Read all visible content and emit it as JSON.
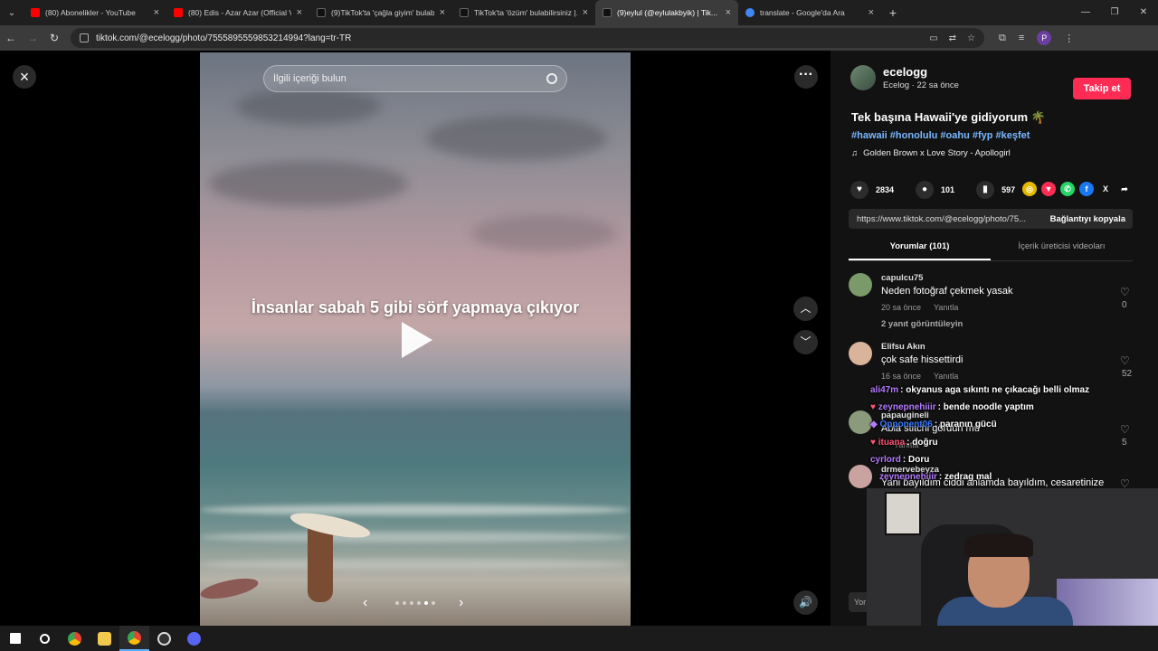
{
  "browser": {
    "tabs": [
      {
        "title": "(80) Abonelikler - YouTube",
        "favicon_color": "#ff0000"
      },
      {
        "title": "(80) Edis - Azar Azar (Official Vi...",
        "favicon_color": "#ff0000"
      },
      {
        "title": "(9)TikTok'ta 'çağla giyim' bulabi...",
        "favicon_color": "#000000"
      },
      {
        "title": "TikTok'ta 'özüm' bulabilirsiniz |...",
        "favicon_color": "#000000"
      },
      {
        "title": "(9)eylul (@eylulakbyik) | Tik...",
        "favicon_color": "#000000",
        "active": true
      },
      {
        "title": "translate - Google'da Ara",
        "favicon_color": "#4285f4"
      }
    ],
    "url": "tiktok.com/@ecelogg/photo/7555895559853214994?lang=tr-TR",
    "profile_initial": "P"
  },
  "viewer": {
    "search_placeholder": "İlgili içeriği bulun",
    "caption": "İnsanlar sabah 5 gibi sörf yapmaya çıkıyor",
    "carousel_dots": 6,
    "carousel_active_dot": 4
  },
  "post": {
    "username": "ecelogg",
    "subline": "Ecelog · 22 sa önce",
    "follow_label": "Takip et",
    "title": "Tek başına Hawaii'ye gidiyorum 🌴",
    "hashtags": "#hawaii #honolulu #oahu #fyp #keşfet",
    "music": "Golden Brown x Love Story - Apollogirl",
    "likes": "2834",
    "comments": "101",
    "saves": "597",
    "link": "https://www.tiktok.com/@ecelogg/photo/75...",
    "copy_label": "Bağlantıyı kopyala",
    "tab_comments": "Yorumlar (101)",
    "tab_creator": "İçerik üreticisi videoları",
    "comment_input_placeholder": "Yor",
    "accent_color": "#fe2c55"
  },
  "comments": [
    {
      "user": "capulcu75",
      "text": "Neden fotoğraf çekmek yasak",
      "time": "20 sa önce",
      "reply": "Yanıtla",
      "likes": "0",
      "replies_label": "2 yanıt görüntüleyin"
    },
    {
      "user": "Elifsu Akın",
      "text": "çok safe hissettirdi",
      "time": "16 sa önce",
      "reply": "Yanıtla",
      "likes": "52"
    },
    {
      "user": "papaugineli",
      "text": "Abla stitchi gördün mü",
      "time": "",
      "reply": "Yanıtla",
      "likes": "5"
    },
    {
      "user": "drmervebeyza",
      "text": "Yani bayıldım ciddi anlamda bayıldım, cesaretinize",
      "time": "",
      "reply": "",
      "likes": ""
    }
  ],
  "chat": [
    {
      "user": "ali47m",
      "msg": ": okyanus aga sıkıntı ne çıkacağı belli olmaz",
      "color": "#b57bff"
    },
    {
      "user": "zeynepnehiiir",
      "msg": ": bende noodle yaptım",
      "color": "#b57bff"
    },
    {
      "user": "Opponent06",
      "msg": ": paranın gücü",
      "color": "#3a7bff"
    },
    {
      "user": "ituana",
      "msg": ": doğru",
      "color": "#ff5577"
    },
    {
      "user": "cyrlord",
      "msg": ": Doru",
      "color": "#b57bff"
    },
    {
      "user": "zeynepnehiiir",
      "msg": ": zedrag mal",
      "color": "#b57bff"
    }
  ]
}
